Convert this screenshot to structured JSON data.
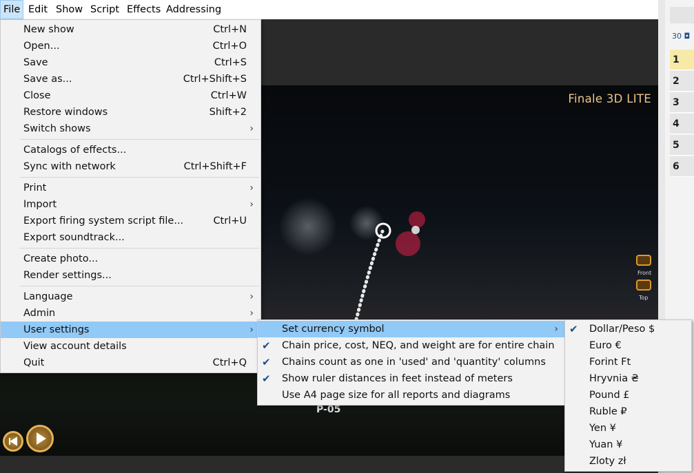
{
  "menubar": {
    "items": [
      "File",
      "Edit",
      "Show",
      "Script",
      "Effects",
      "Addressing"
    ]
  },
  "file_menu": {
    "groups": [
      [
        {
          "label": "New show",
          "shortcut": "Ctrl+N"
        },
        {
          "label": "Open...",
          "shortcut": "Ctrl+O"
        },
        {
          "label": "Save",
          "shortcut": "Ctrl+S"
        },
        {
          "label": "Save as...",
          "shortcut": "Ctrl+Shift+S"
        },
        {
          "label": "Close",
          "shortcut": "Ctrl+W"
        },
        {
          "label": "Restore windows",
          "shortcut": "Shift+2"
        },
        {
          "label": "Switch shows",
          "shortcut": "",
          "submenu": true
        }
      ],
      [
        {
          "label": "Catalogs of effects...",
          "shortcut": ""
        },
        {
          "label": "Sync with network",
          "shortcut": "Ctrl+Shift+F"
        }
      ],
      [
        {
          "label": "Print",
          "shortcut": "",
          "submenu": true
        },
        {
          "label": "Import",
          "shortcut": "",
          "submenu": true
        },
        {
          "label": "Export firing system script file...",
          "shortcut": "Ctrl+U"
        },
        {
          "label": "Export soundtrack...",
          "shortcut": ""
        }
      ],
      [
        {
          "label": "Create photo...",
          "shortcut": ""
        },
        {
          "label": "Render settings...",
          "shortcut": ""
        }
      ],
      [
        {
          "label": "Language",
          "shortcut": "",
          "submenu": true
        },
        {
          "label": "Admin",
          "shortcut": "",
          "submenu": true
        },
        {
          "label": "User settings",
          "shortcut": "",
          "submenu": true,
          "highlighted": true
        },
        {
          "label": "View account details",
          "shortcut": ""
        },
        {
          "label": "Quit",
          "shortcut": "Ctrl+Q"
        }
      ]
    ]
  },
  "user_settings_menu": [
    {
      "label": "Set currency symbol",
      "checked": false,
      "submenu": true,
      "highlighted": true
    },
    {
      "label": "Chain price, cost, NEQ, and weight are for entire chain",
      "checked": true
    },
    {
      "label": "Chains count as one in 'used' and 'quantity' columns",
      "checked": true
    },
    {
      "label": "Show ruler distances in feet instead of meters",
      "checked": true
    },
    {
      "label": "Use A4 page size for all reports and diagrams",
      "checked": false
    }
  ],
  "currency_menu": [
    {
      "label": "Dollar/Peso $",
      "checked": true
    },
    {
      "label": "Euro €",
      "checked": false
    },
    {
      "label": "Forint Ft",
      "checked": false
    },
    {
      "label": "Hryvnia ₴",
      "checked": false
    },
    {
      "label": "Pound £",
      "checked": false
    },
    {
      "label": "Ruble ₽",
      "checked": false
    },
    {
      "label": "Yen ¥",
      "checked": false
    },
    {
      "label": "Yuan ¥",
      "checked": false
    },
    {
      "label": "Zloty zł",
      "checked": false
    }
  ],
  "viewport": {
    "brand": "Finale 3D LITE",
    "camera_front": "Front",
    "camera_top": "Top",
    "position_label": "P-05"
  },
  "right_panel": {
    "count": "30",
    "rows": [
      "1",
      "2",
      "3",
      "4",
      "5",
      "6"
    ]
  },
  "colors": {
    "menu_bg": "#f2f2f2",
    "highlight": "#91c9f7",
    "check": "#1f4e8a",
    "brand": "#f0c888"
  }
}
